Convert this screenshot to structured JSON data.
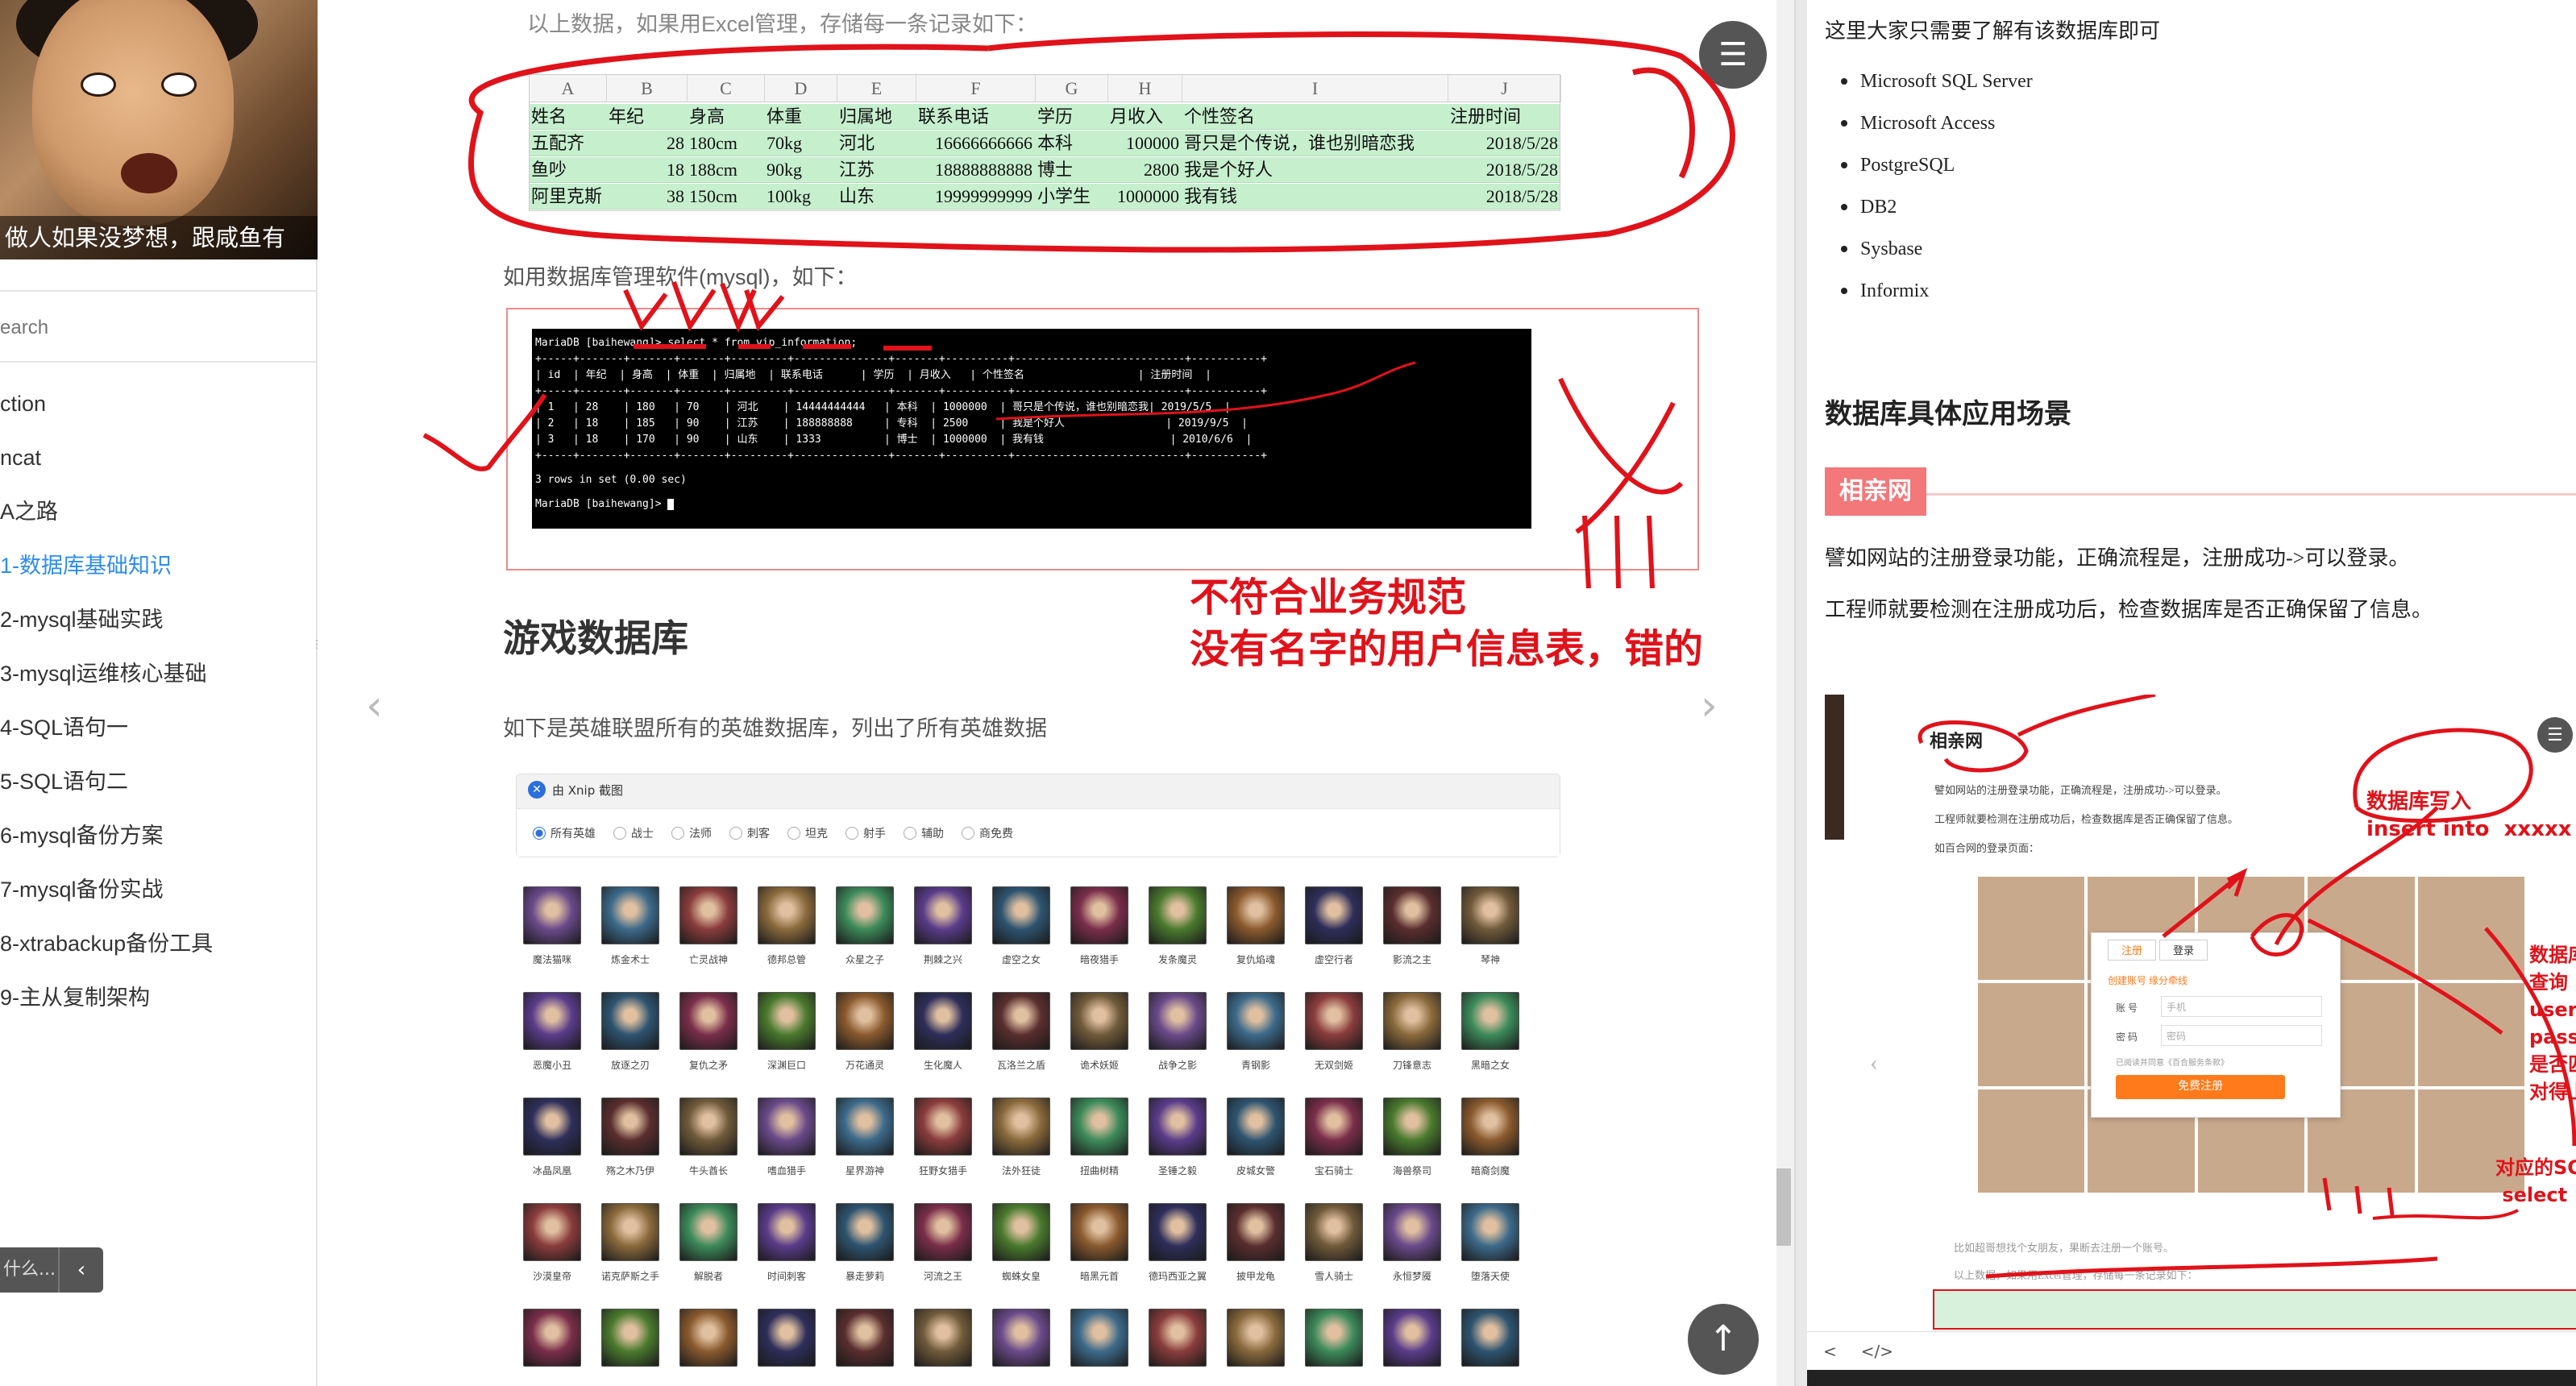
{
  "sidebar": {
    "avatar_caption": "做人如果没梦想，跟咸鱼有",
    "search_placeholder": "earch",
    "nav_items": [
      {
        "label": "ction",
        "active": false
      },
      {
        "label": "ncat",
        "active": false
      },
      {
        "label": "A之路",
        "active": false
      },
      {
        "label": "1-数据库基础知识",
        "active": true
      },
      {
        "label": "2-mysql基础实践",
        "active": false
      },
      {
        "label": "3-mysql运维核心基础",
        "active": false
      },
      {
        "label": "4-SQL语句一",
        "active": false
      },
      {
        "label": "5-SQL语句二",
        "active": false
      },
      {
        "label": "6-mysql备份方案",
        "active": false
      },
      {
        "label": "7-mysql备份实战",
        "active": false
      },
      {
        "label": "8-xtrabackup备份工具",
        "active": false
      },
      {
        "label": "9-主从复制架构",
        "active": false
      }
    ],
    "bottom_search_text": "什么...",
    "collapse_icon": "chevron-left-icon"
  },
  "main": {
    "intro_text": "以上数据，如果用Excel管理，存储每一条记录如下：",
    "excel": {
      "column_letters": [
        "A",
        "B",
        "C",
        "D",
        "E",
        "F",
        "G",
        "H",
        "I",
        "J"
      ],
      "header": [
        "姓名",
        "年纪",
        "身高",
        "体重",
        "归属地",
        "联系电话",
        "学历",
        "月收入",
        "个性签名",
        "注册时间"
      ],
      "rows": [
        [
          "五配齐",
          "28",
          "180cm",
          "70kg",
          "河北",
          "16666666666",
          "本科",
          "100000",
          "哥只是个传说，谁也别暗恋我",
          "2018/5/28"
        ],
        [
          "鱼吵",
          "18",
          "188cm",
          "90kg",
          "江苏",
          "18888888888",
          "博士",
          "2800",
          "我是个好人",
          "2018/5/28"
        ],
        [
          "阿里克斯",
          "38",
          "150cm",
          "100kg",
          "山东",
          "19999999999",
          "小学生",
          "1000000",
          "我有钱",
          "2018/5/28"
        ]
      ]
    },
    "mysql_text": "如用数据库管理软件(mysql)，如下：",
    "terminal": {
      "prompt": "MariaDB [baihewang]>",
      "command": "select * from vip_information;",
      "headers": [
        "id",
        "年纪",
        "身高",
        "体重",
        "归属地",
        "联系电话",
        "学历",
        "月收入",
        "个性签名",
        "注册时间"
      ],
      "rows": [
        [
          "1",
          "28",
          "180",
          "70",
          "河北",
          "14444444444",
          "本科",
          "1000000",
          "哥只是个传说，谁也别暗恋我",
          "2019/5/5"
        ],
        [
          "2",
          "18",
          "185",
          "90",
          "江苏",
          "188888888",
          "专科",
          "2500",
          "我是个好人",
          "2019/9/5"
        ],
        [
          "3",
          "18",
          "170",
          "90",
          "山东",
          "1333",
          "博士",
          "1000000",
          "我有钱",
          "2010/6/6"
        ]
      ],
      "summary": "3 rows in set (0.00 sec)"
    },
    "annotation_line1": "不符合业务规范",
    "annotation_line2": "没有名字的用户信息表，错的",
    "section_heading": "游戏数据库",
    "hero_description": "如下是英雄联盟所有的英雄数据库，列出了所有英雄数据",
    "xnip_title": "由 Xnip 截图",
    "filters": [
      {
        "label": "所有英雄",
        "checked": true
      },
      {
        "label": "战士",
        "checked": false
      },
      {
        "label": "法师",
        "checked": false
      },
      {
        "label": "刺客",
        "checked": false
      },
      {
        "label": "坦克",
        "checked": false
      },
      {
        "label": "射手",
        "checked": false
      },
      {
        "label": "辅助",
        "checked": false
      },
      {
        "label": "商免费",
        "checked": false
      }
    ],
    "heroes": [
      [
        "魔法猫咪",
        "炼金术士",
        "亡灵战神",
        "德邦总管",
        "众星之子",
        "荆棘之兴",
        "虚空之女",
        "暗夜猎手",
        "发条魔灵",
        "复仇焰魂",
        "虚空行者",
        "影流之主",
        "琴神"
      ],
      [
        "恶魔小丑",
        "放逐之刃",
        "复仇之矛",
        "深渊巨口",
        "万花通灵",
        "生化魔人",
        "瓦洛兰之盾",
        "诡术妖姬",
        "战争之影",
        "青钢影",
        "无双剑姬",
        "刀锋意志",
        "黑暗之女"
      ],
      [
        "冰晶凤凰",
        "殇之木乃伊",
        "牛头酋长",
        "嗜血猎手",
        "星界游神",
        "狂野女猎手",
        "法外狂徒",
        "扭曲树精",
        "圣锤之毅",
        "皮城女警",
        "宝石骑士",
        "海兽祭司",
        "暗裔剑魔"
      ],
      [
        "沙漠皇帝",
        "诺克萨斯之手",
        "解脱者",
        "时间刺客",
        "暴走萝莉",
        "河流之王",
        "蜘蛛女皇",
        "暗黑元首",
        "德玛西亚之翼",
        "披甲龙龟",
        "雪人骑士",
        "永恒梦魇",
        "堕落天使"
      ],
      [
        "",
        "",
        "",
        "",
        "",
        "",
        "",
        "",
        "",
        "",
        "",
        "",
        ""
      ]
    ],
    "menu_icon": "hamburger-menu-icon",
    "back_to_top_icon": "arrow-up-icon",
    "prev_icon": "chevron-left-icon",
    "next_icon": "chevron-right-icon"
  },
  "right": {
    "intro": "这里大家只需要了解有该数据库即可",
    "databases": [
      "Microsoft SQL Server",
      "Microsoft Access",
      "PostgreSQL",
      "DB2",
      "Sysbase",
      "Informix"
    ],
    "heading": "数据库具体应用场景",
    "badge": "相亲网",
    "para1": "譬如网站的注册登录功能，正确流程是，注册成功->可以登录。",
    "para2": "工程师就要检测在注册成功后，检查数据库是否正确保留了信息。",
    "shot": {
      "heading": "相亲网",
      "line1": "譬如网站的注册登录功能，正确流程是，注册成功->可以登录。",
      "line2": "工程师就要检测在注册成功后，检查数据库是否正确保留了信息。",
      "line3": "如百合网的登录页面：",
      "tab_register": "注册",
      "tab_login": "登录",
      "link_create": "创建账号  缘分牵线",
      "account_label": "账  号",
      "account_placeholder": "手机",
      "password_label": "密  码",
      "password_placeholder": "密码",
      "agree_text": "已阅读并同意《百合服务条款》",
      "register_button": "免费注册",
      "line4": "比如超哥想找个女朋友，果断去注册一个账号。",
      "line5": "以上数据，如果用Excel管理，存储每一条记录如下："
    },
    "ann_insert": "数据库写入\ninsert into  xxxxx",
    "ann_query": "数据库\n查询\nuserna\npasswo\n是否匹\n对得上",
    "ann_sql": "对应的SQ\n select  u",
    "toolbar_left": "<",
    "toolbar_code": "</>",
    "right_menu_icon": "hamburger-menu-icon"
  }
}
